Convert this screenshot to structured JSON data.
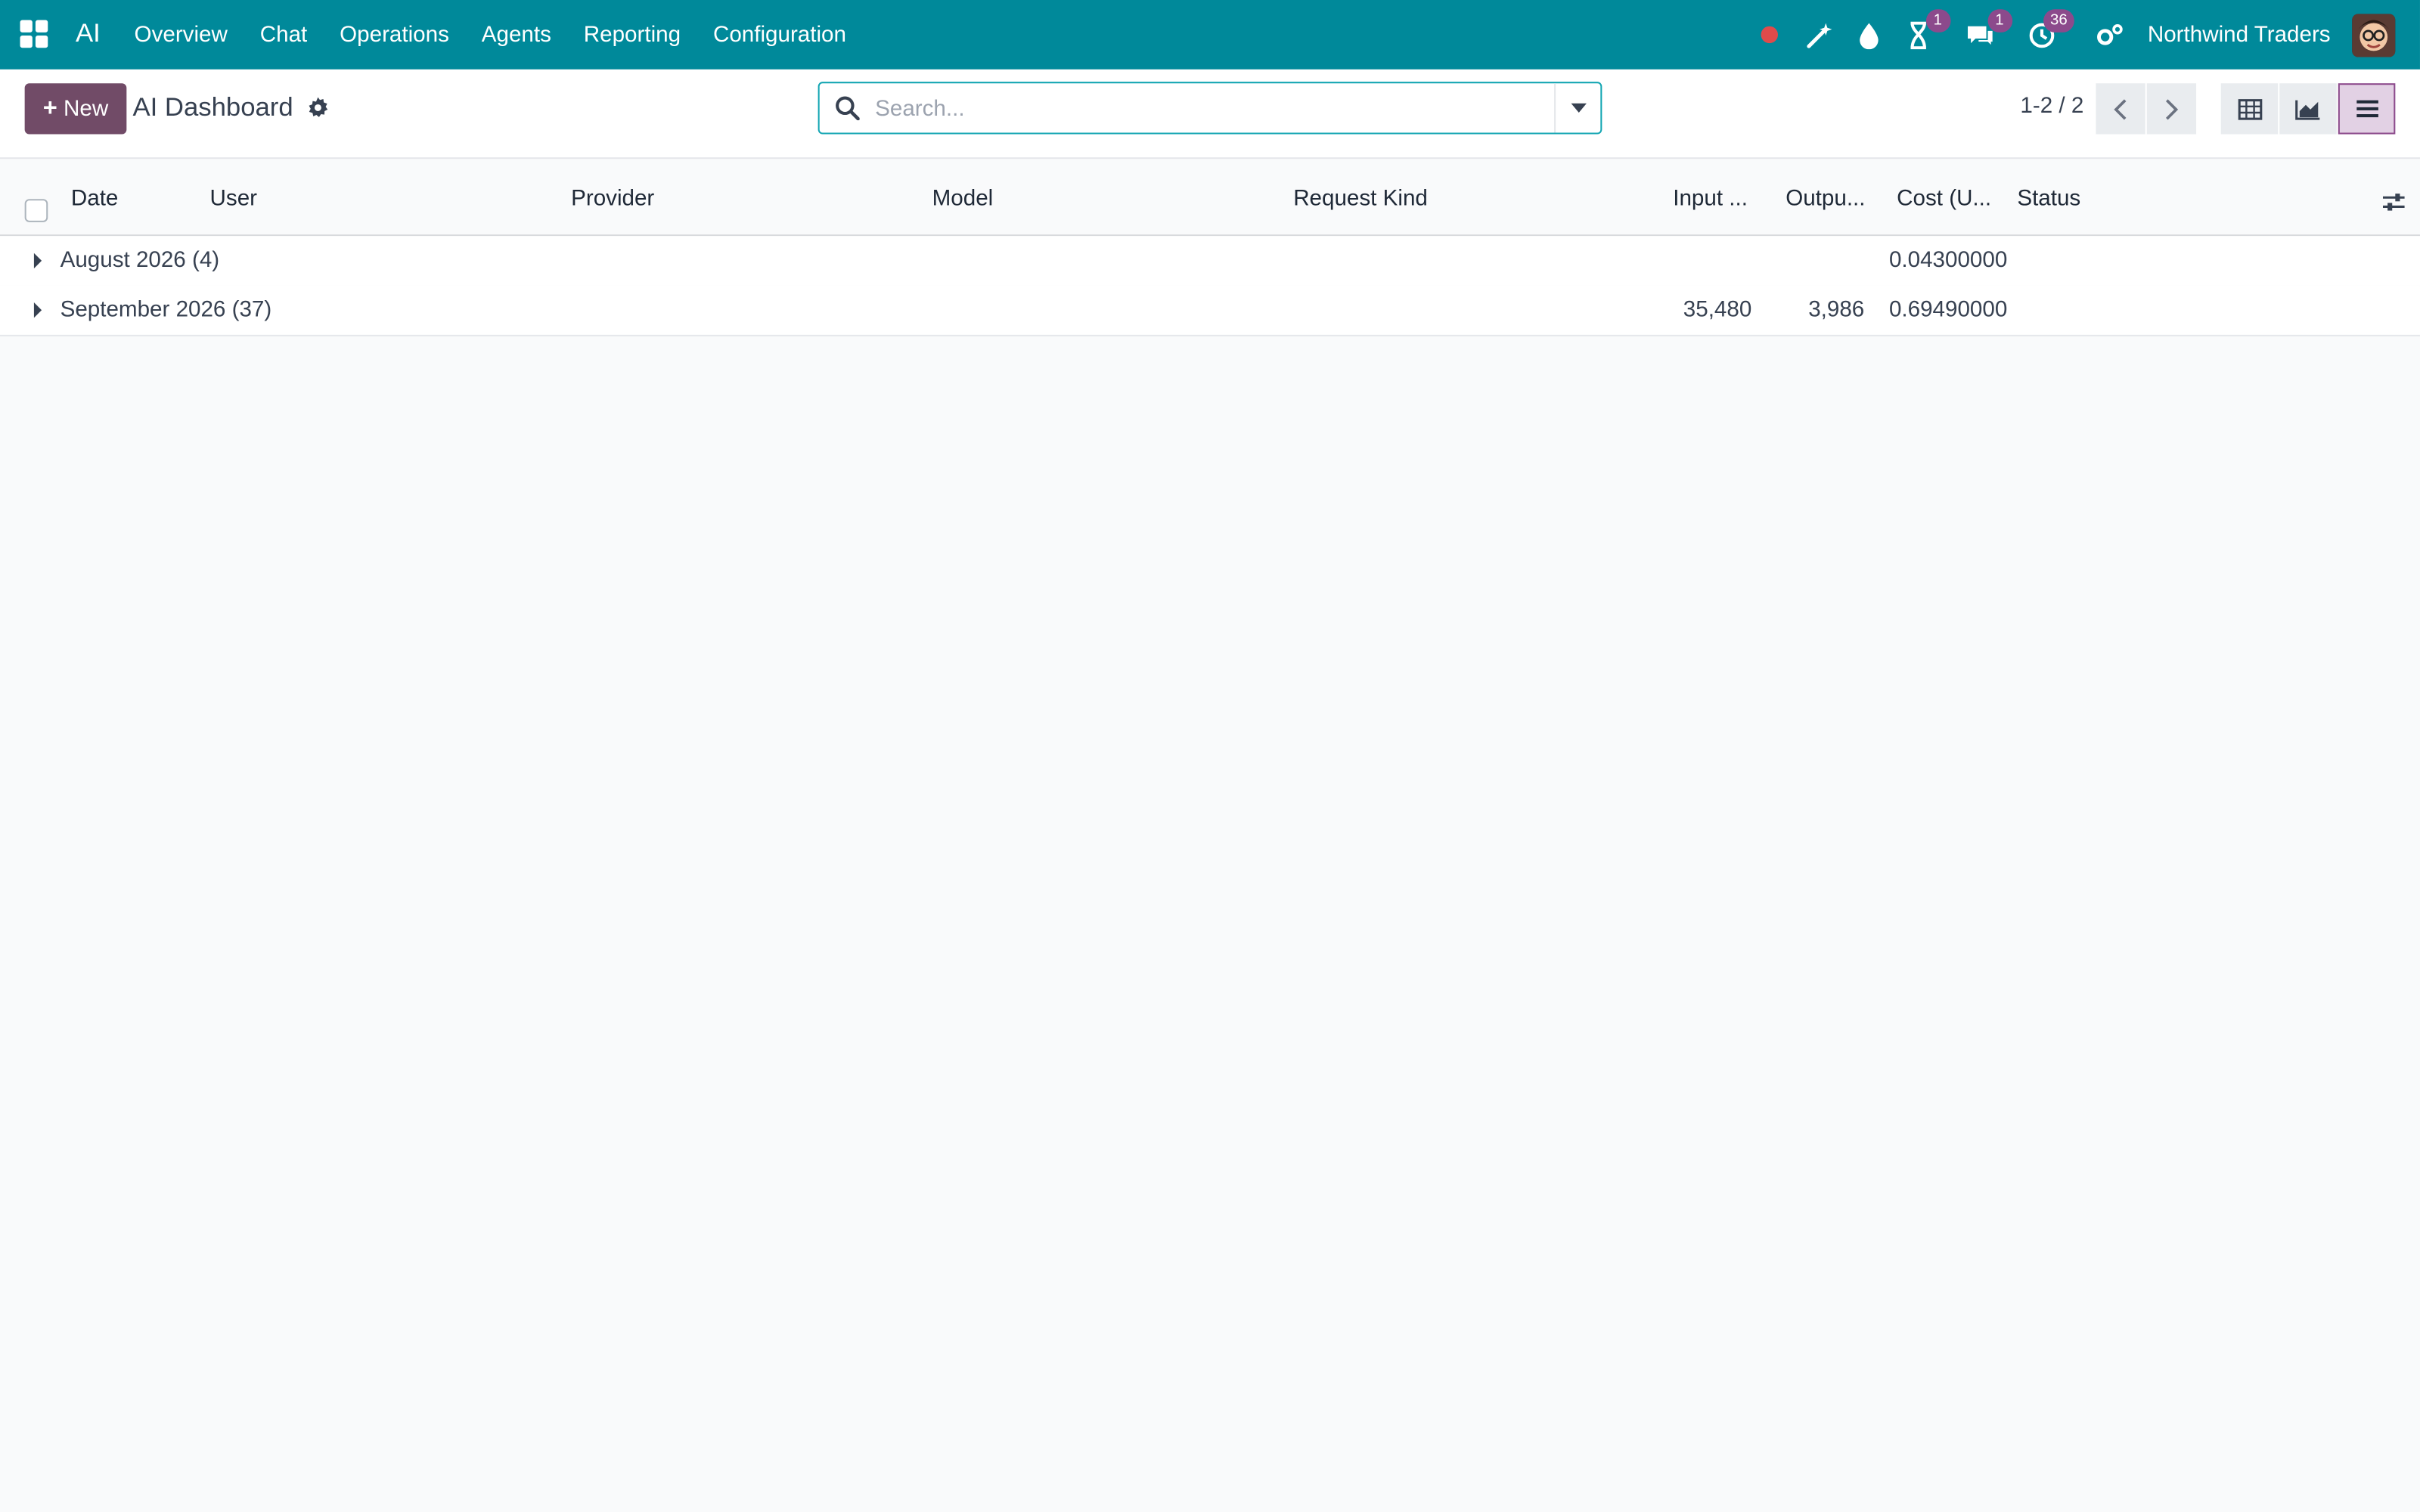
{
  "navbar": {
    "brand": "AI",
    "menu": [
      "Overview",
      "Chat",
      "Operations",
      "Agents",
      "Reporting",
      "Configuration"
    ],
    "activity_badge": "1",
    "messages_badge": "1",
    "clock_badge": "36",
    "company": "Northwind Traders"
  },
  "control": {
    "new_label": "New",
    "title": "AI Dashboard",
    "search_placeholder": "Search...",
    "pager": "1-2 / 2"
  },
  "table": {
    "columns": [
      "Date",
      "User",
      "Provider",
      "Model",
      "Request Kind",
      "Input ...",
      "Outpu...",
      "Cost (U...",
      "Status"
    ],
    "groups": [
      {
        "label": "August 2026 (4)",
        "input": "",
        "output": "",
        "cost": "0.04300000"
      },
      {
        "label": "September 2026 (37)",
        "input": "35,480",
        "output": "3,986",
        "cost": "0.69490000"
      }
    ]
  },
  "colors": {
    "navbar": "#00899a",
    "primary": "#714b67",
    "badge": "#8c4a8c"
  }
}
